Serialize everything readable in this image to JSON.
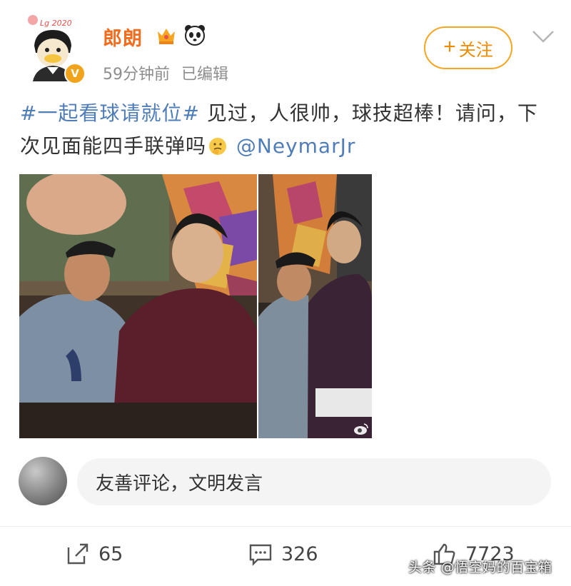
{
  "post": {
    "username": "郎朗",
    "avatar_caption": "Lg 2020",
    "time": "59分钟前",
    "edited": "已编辑",
    "follow_label": "关注",
    "content": {
      "hashtag": "#一起看球请就位#",
      "text_1": " 见过，人很帅，球技超棒！请问，下次见面能四手联弹吗",
      "mention": " @NeymarJr"
    }
  },
  "comment_box": {
    "placeholder": "友善评论，文明发言"
  },
  "actions": {
    "shares": "65",
    "comments": "326",
    "likes": "7723"
  },
  "watermark": "头条 @悟空妈的百宝箱",
  "colors": {
    "username": "#f36b1c",
    "link": "#4f7db8",
    "follow": "#f5a623"
  }
}
